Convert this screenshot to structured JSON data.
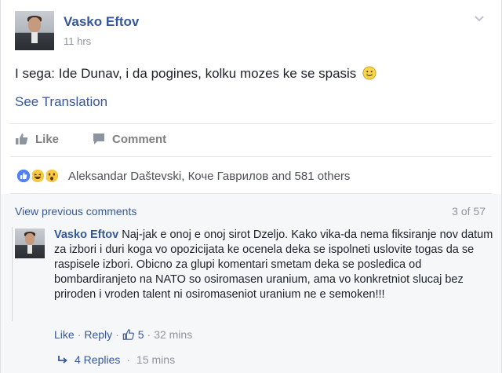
{
  "post": {
    "author": "Vasko Eftov",
    "time": "11 hrs",
    "text": "I sega: Ide Dunav, i da pogines, kolku mozes ke se spasis",
    "emoji": "slightly-smiling-face",
    "see_translation": "See Translation"
  },
  "actions": {
    "like": "Like",
    "comment": "Comment"
  },
  "reactions": {
    "icons": [
      "like-reaction",
      "haha-reaction",
      "wow-reaction"
    ],
    "names": "Aleksandar Daštevski, Коче Гаврилов and 581 others"
  },
  "comments": {
    "view_previous": "View previous comments",
    "count": "3 of 57",
    "item": {
      "author": "Vasko Eftov",
      "text": "Naj-jak e onoj e onoj sirot Dzeljo. Kako vika-da nema fiksiranje nov datum za izbori i duri koga vo opozicijata ke ocenela deka se ispolneti uslovite togas da se raspisele izbori. Obicno za glupi komentari smetam deka se posledica od bombardiranjeto na NATO so osiromasen uranium, ama vo konkretniot slucaj bez priroden i vroden talent ni osiromaseniot uranium ne e semoken!!!",
      "like": "Like",
      "sep1": "·",
      "reply": "Reply",
      "sep2": "·",
      "likes": "5",
      "sep3": "·",
      "time": "32 mins"
    },
    "replies": {
      "label": "4 Replies",
      "sep": "·",
      "time": "15 mins"
    }
  },
  "colors": {
    "link": "#365899",
    "meta": "#90949c",
    "text": "#1d2129"
  }
}
